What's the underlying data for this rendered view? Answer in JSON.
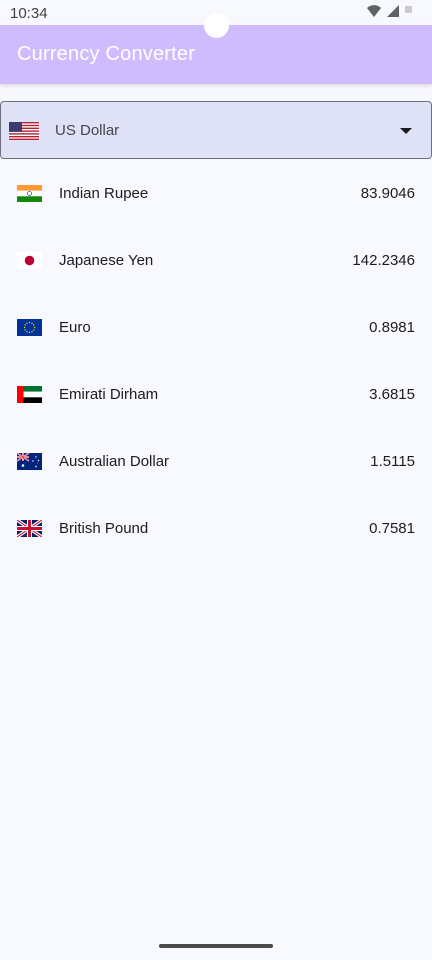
{
  "status_bar": {
    "time": "10:34"
  },
  "app_bar": {
    "title": "Currency Converter",
    "color": "#cfbcff"
  },
  "base_currency": {
    "label": "US Dollar",
    "flag_icon": "us-flag-icon"
  },
  "currencies": [
    {
      "name": "Indian Rupee",
      "rate": "83.9046",
      "flag_icon": "india-flag-icon"
    },
    {
      "name": "Japanese Yen",
      "rate": "142.2346",
      "flag_icon": "japan-flag-icon"
    },
    {
      "name": "Euro",
      "rate": "0.8981",
      "flag_icon": "eu-flag-icon"
    },
    {
      "name": "Emirati Dirham",
      "rate": "3.6815",
      "flag_icon": "uae-flag-icon"
    },
    {
      "name": "Australian Dollar",
      "rate": "1.5115",
      "flag_icon": "australia-flag-icon"
    },
    {
      "name": "British Pound",
      "rate": "0.7581",
      "flag_icon": "uk-flag-icon"
    }
  ]
}
